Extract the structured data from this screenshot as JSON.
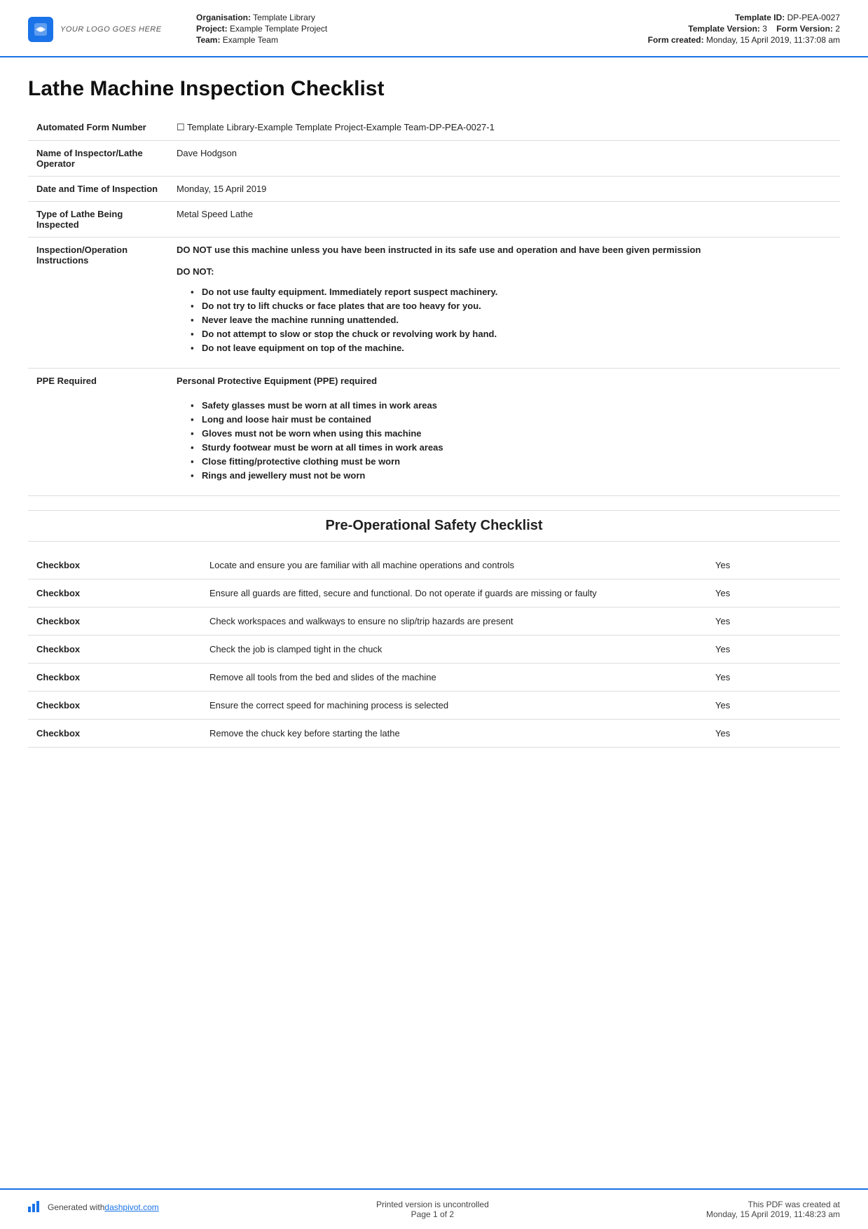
{
  "header": {
    "logo_text": "YOUR LOGO GOES HERE",
    "org_label": "Organisation:",
    "org_value": "Template Library",
    "project_label": "Project:",
    "project_value": "Example Template Project",
    "team_label": "Team:",
    "team_value": "Example Team",
    "template_id_label": "Template ID:",
    "template_id_value": "DP-PEA-0027",
    "template_version_label": "Template Version:",
    "template_version_value": "3",
    "form_version_label": "Form Version:",
    "form_version_value": "2",
    "form_created_label": "Form created:",
    "form_created_value": "Monday, 15 April 2019, 11:37:08 am"
  },
  "document": {
    "title": "Lathe Machine Inspection Checklist",
    "fields": [
      {
        "label": "Automated Form Number",
        "value": "Template Library-Example Template Project-Example Team-DP-PEA-0027-1",
        "has_icon": true
      },
      {
        "label": "Name of Inspector/Lathe Operator",
        "value": "Dave Hodgson"
      },
      {
        "label": "Date and Time of Inspection",
        "value": "Monday, 15 April 2019"
      },
      {
        "label": "Type of Lathe Being Inspected",
        "value": "Metal Speed Lathe"
      },
      {
        "label": "Inspection/Operation Instructions",
        "main_text": "DO NOT use this machine unless you have been instructed in its safe use and operation and have been given permission",
        "do_not_label": "DO NOT:",
        "bullets": [
          "Do not use faulty equipment. Immediately report suspect machinery.",
          "Do not try to lift chucks or face plates that are too heavy for you.",
          "Never leave the machine running unattended.",
          "Do not attempt to slow or stop the chuck or revolving work by hand.",
          "Do not leave equipment on top of the machine."
        ]
      },
      {
        "label": "PPE Required",
        "main_text": "Personal Protective Equipment (PPE) required",
        "bullets": [
          "Safety glasses must be worn at all times in work areas",
          "Long and loose hair must be contained",
          "Gloves must not be worn when using this machine",
          "Sturdy footwear must be worn at all times in work areas",
          "Close fitting/protective clothing must be worn",
          "Rings and jewellery must not be worn"
        ]
      }
    ]
  },
  "checklist": {
    "section_title": "Pre-Operational Safety Checklist",
    "items": [
      {
        "col1": "Checkbox",
        "col2": "Locate and ensure you are familiar with all machine operations and controls",
        "col3": "Yes"
      },
      {
        "col1": "Checkbox",
        "col2": "Ensure all guards are fitted, secure and functional. Do not operate if guards are missing or faulty",
        "col3": "Yes"
      },
      {
        "col1": "Checkbox",
        "col2": "Check workspaces and walkways to ensure no slip/trip hazards are present",
        "col3": "Yes"
      },
      {
        "col1": "Checkbox",
        "col2": "Check the job is clamped tight in the chuck",
        "col3": "Yes"
      },
      {
        "col1": "Checkbox",
        "col2": "Remove all tools from the bed and slides of the machine",
        "col3": "Yes"
      },
      {
        "col1": "Checkbox",
        "col2": "Ensure the correct speed for machining process is selected",
        "col3": "Yes"
      },
      {
        "col1": "Checkbox",
        "col2": "Remove the chuck key before starting the lathe",
        "col3": "Yes"
      }
    ]
  },
  "footer": {
    "generated_text": "Generated with ",
    "link_text": "dashpivot.com",
    "uncontrolled_text": "Printed version is uncontrolled",
    "page_text": "Page 1 of 2",
    "pdf_created_label": "This PDF was created at",
    "pdf_created_value": "Monday, 15 April 2019, 11:48:23 am"
  }
}
